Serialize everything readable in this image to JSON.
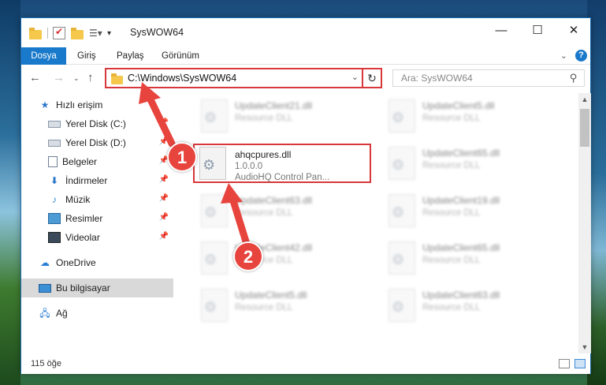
{
  "window": {
    "title": "SysWOW64",
    "minimize": "—",
    "maximize": "☐",
    "close": "✕"
  },
  "ribbon": {
    "tabs": [
      "Dosya",
      "Giriş",
      "Paylaş",
      "Görünüm"
    ]
  },
  "address": {
    "path": "C:\\Windows\\SysWOW64",
    "search_placeholder": "Ara: SysWOW64"
  },
  "sidebar": {
    "items": [
      {
        "label": "Hızlı erişim",
        "icon": "star-icon"
      },
      {
        "label": "Yerel Disk (C:)",
        "icon": "drive-icon",
        "pinned": true
      },
      {
        "label": "Yerel Disk (D:)",
        "icon": "drive-icon",
        "pinned": true
      },
      {
        "label": "Belgeler",
        "icon": "documents-icon",
        "pinned": true
      },
      {
        "label": "İndirmeler",
        "icon": "downloads-icon",
        "pinned": true
      },
      {
        "label": "Müzik",
        "icon": "music-icon",
        "pinned": true
      },
      {
        "label": "Resimler",
        "icon": "pictures-icon",
        "pinned": true
      },
      {
        "label": "Videolar",
        "icon": "videos-icon",
        "pinned": true
      },
      {
        "label": "OneDrive",
        "icon": "cloud-icon"
      },
      {
        "label": "Bu bilgisayar",
        "icon": "computer-icon",
        "selected": true
      },
      {
        "label": "Ağ",
        "icon": "network-icon"
      }
    ]
  },
  "files": {
    "highlighted": {
      "name": "ahqcpures.dll",
      "version": "1.0.0.0",
      "description": "AudioHQ Control Pan..."
    },
    "left_column": [
      {
        "name": "UpdateClient21.dll",
        "type": "Resource DLL"
      },
      {
        "name": "UpdateClient63.dll",
        "type": "Resource DLL"
      },
      {
        "name": "UpdateClient42.dll",
        "type": "Resource DLL"
      },
      {
        "name": "UpdateClient5.dll",
        "type": "Resource DLL"
      }
    ],
    "right_column": [
      {
        "name": "UpdateClient5.dll",
        "type": "Resource DLL"
      },
      {
        "name": "UpdateClient65.dll",
        "type": "Resource DLL"
      },
      {
        "name": "UpdateClient19.dll",
        "type": "Resource DLL"
      },
      {
        "name": "UpdateClient65.dll",
        "type": "Resource DLL"
      },
      {
        "name": "UpdateClient63.dll",
        "type": "Resource DLL"
      }
    ]
  },
  "status": {
    "item_count": "115 öğe"
  },
  "annotations": {
    "step1": "1",
    "step2": "2",
    "color": "#e8443e"
  }
}
